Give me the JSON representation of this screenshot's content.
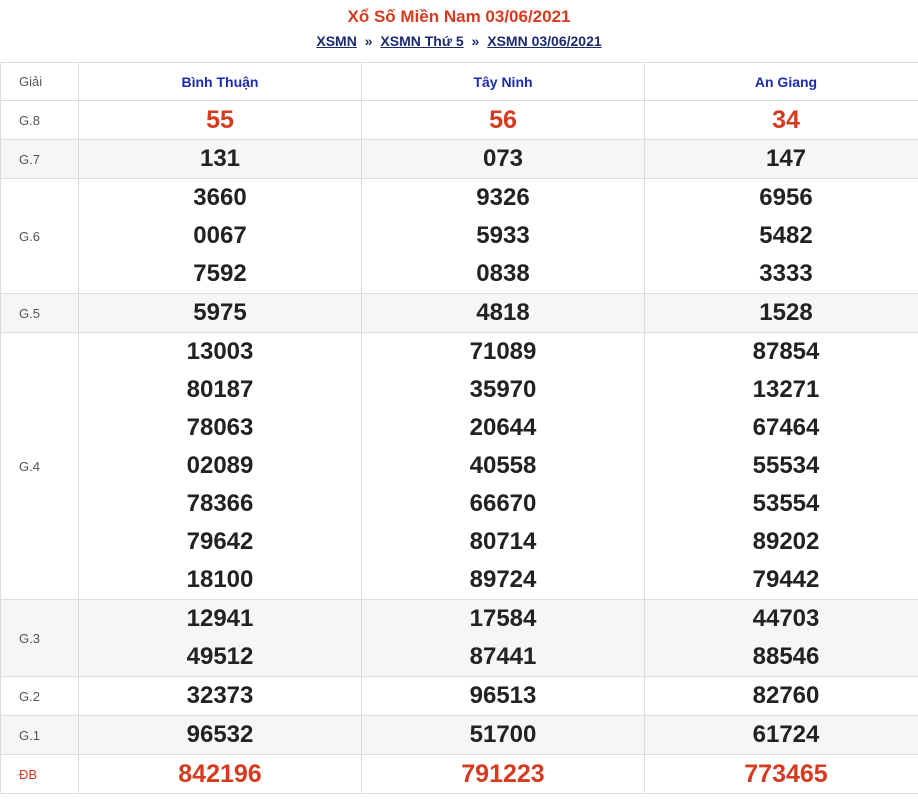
{
  "header": {
    "title": "Xổ Số Miền Nam 03/06/2021",
    "crumbs": [
      "XSMN",
      "XSMN Thứ 5",
      "XSMN 03/06/2021"
    ],
    "separator": "»"
  },
  "table": {
    "label_header": "Giải",
    "provinces": [
      "Bình Thuận",
      "Tây Ninh",
      "An Giang"
    ],
    "rows": [
      {
        "label": "G.8",
        "alt": false,
        "highlight": true,
        "values": [
          [
            "55"
          ],
          [
            "56"
          ],
          [
            "34"
          ]
        ]
      },
      {
        "label": "G.7",
        "alt": true,
        "highlight": false,
        "values": [
          [
            "131"
          ],
          [
            "073"
          ],
          [
            "147"
          ]
        ]
      },
      {
        "label": "G.6",
        "alt": false,
        "highlight": false,
        "values": [
          [
            "3660",
            "0067",
            "7592"
          ],
          [
            "9326",
            "5933",
            "0838"
          ],
          [
            "6956",
            "5482",
            "3333"
          ]
        ]
      },
      {
        "label": "G.5",
        "alt": true,
        "highlight": false,
        "values": [
          [
            "5975"
          ],
          [
            "4818"
          ],
          [
            "1528"
          ]
        ]
      },
      {
        "label": "G.4",
        "alt": false,
        "highlight": false,
        "values": [
          [
            "13003",
            "80187",
            "78063",
            "02089",
            "78366",
            "79642",
            "18100"
          ],
          [
            "71089",
            "35970",
            "20644",
            "40558",
            "66670",
            "80714",
            "89724"
          ],
          [
            "87854",
            "13271",
            "67464",
            "55534",
            "53554",
            "89202",
            "79442"
          ]
        ]
      },
      {
        "label": "G.3",
        "alt": true,
        "highlight": false,
        "values": [
          [
            "12941",
            "49512"
          ],
          [
            "17584",
            "87441"
          ],
          [
            "44703",
            "88546"
          ]
        ]
      },
      {
        "label": "G.2",
        "alt": false,
        "highlight": false,
        "values": [
          [
            "32373"
          ],
          [
            "96513"
          ],
          [
            "82760"
          ]
        ]
      },
      {
        "label": "G.1",
        "alt": true,
        "highlight": false,
        "values": [
          [
            "96532"
          ],
          [
            "51700"
          ],
          [
            "61724"
          ]
        ]
      },
      {
        "label": "ĐB",
        "alt": false,
        "highlight": true,
        "values": [
          [
            "842196"
          ],
          [
            "791223"
          ],
          [
            "773465"
          ]
        ]
      }
    ]
  },
  "colors": {
    "accent_red": "#d63a1f",
    "province_blue": "#1a2bb0",
    "link_navy": "#1a2b6d"
  }
}
